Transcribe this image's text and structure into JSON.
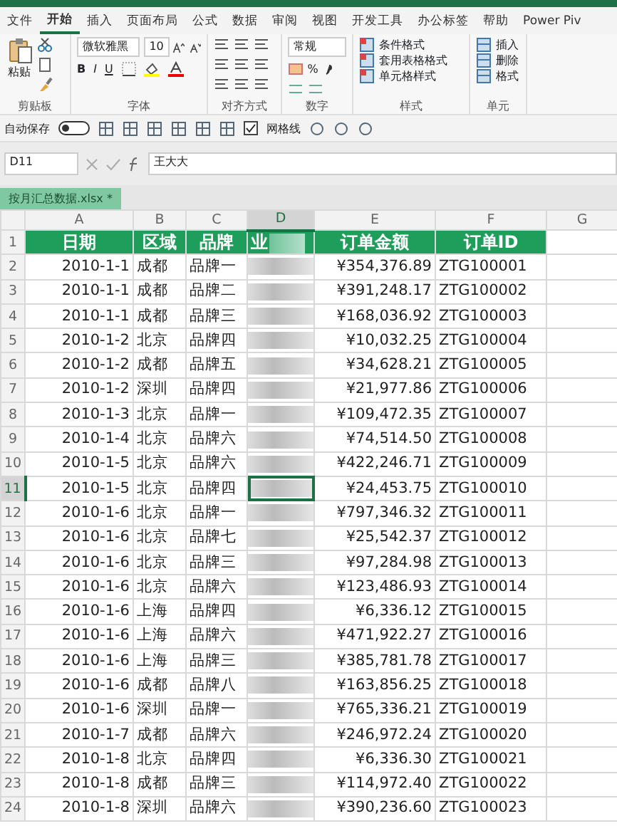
{
  "ribbon_tabs": [
    {
      "label": "文件",
      "selected": false
    },
    {
      "label": "开始",
      "selected": true
    },
    {
      "label": "插入",
      "selected": false
    },
    {
      "label": "页面布局",
      "selected": false
    },
    {
      "label": "公式",
      "selected": false
    },
    {
      "label": "数据",
      "selected": false
    },
    {
      "label": "审阅",
      "selected": false
    },
    {
      "label": "视图",
      "selected": false
    },
    {
      "label": "开发工具",
      "selected": false
    },
    {
      "label": "办公标签",
      "selected": false
    },
    {
      "label": "帮助",
      "selected": false
    },
    {
      "label": "Power Piv",
      "selected": false
    }
  ],
  "clipboard": {
    "paste": "粘贴",
    "label": "剪贴板"
  },
  "font": {
    "name": "微软雅黑",
    "size": "10",
    "bold": "B",
    "italic": "I",
    "underline": "U",
    "label": "字体"
  },
  "alignment": {
    "label": "对齐方式"
  },
  "number": {
    "format": "常规",
    "percent": "%",
    "label": "数字"
  },
  "styles": {
    "items": [
      "条件格式",
      "套用表格格式",
      "单元格样式"
    ],
    "label": "样式"
  },
  "cells": {
    "items": [
      "插入",
      "删除",
      "格式"
    ],
    "label": "单元"
  },
  "quick_access": {
    "autosave": "自动保存",
    "autosave_on": false,
    "gridlines": "网格线",
    "gridlines_checked": true
  },
  "formula_bar": {
    "name_box": "D11",
    "value": "王大大"
  },
  "file_tab": {
    "name": "按月汇总数据.xlsx *"
  },
  "sheet": {
    "columns": [
      {
        "letter": "A",
        "selected": false
      },
      {
        "letter": "B",
        "selected": false
      },
      {
        "letter": "C",
        "selected": false
      },
      {
        "letter": "D",
        "selected": true
      },
      {
        "letter": "E",
        "selected": false
      },
      {
        "letter": "F",
        "selected": false
      },
      {
        "letter": "G",
        "selected": false
      }
    ],
    "header_row": {
      "num": "1",
      "cells": [
        "日期",
        "区域",
        "品牌",
        "业",
        "订单金额",
        "订单ID"
      ]
    },
    "rows": [
      {
        "num": "2",
        "selected": false,
        "date": "2010-1-1",
        "region": "成都",
        "brand": "品牌一",
        "amount": "¥354,376.89",
        "order_id": "ZTG100001"
      },
      {
        "num": "3",
        "selected": false,
        "date": "2010-1-1",
        "region": "成都",
        "brand": "品牌二",
        "amount": "¥391,248.17",
        "order_id": "ZTG100002"
      },
      {
        "num": "4",
        "selected": false,
        "date": "2010-1-1",
        "region": "成都",
        "brand": "品牌三",
        "amount": "¥168,036.92",
        "order_id": "ZTG100003"
      },
      {
        "num": "5",
        "selected": false,
        "date": "2010-1-2",
        "region": "北京",
        "brand": "品牌四",
        "amount": "¥10,032.25",
        "order_id": "ZTG100004"
      },
      {
        "num": "6",
        "selected": false,
        "date": "2010-1-2",
        "region": "成都",
        "brand": "品牌五",
        "amount": "¥34,628.21",
        "order_id": "ZTG100005"
      },
      {
        "num": "7",
        "selected": false,
        "date": "2010-1-2",
        "region": "深圳",
        "brand": "品牌四",
        "amount": "¥21,977.86",
        "order_id": "ZTG100006"
      },
      {
        "num": "8",
        "selected": false,
        "date": "2010-1-3",
        "region": "北京",
        "brand": "品牌一",
        "amount": "¥109,472.35",
        "order_id": "ZTG100007"
      },
      {
        "num": "9",
        "selected": false,
        "date": "2010-1-4",
        "region": "北京",
        "brand": "品牌六",
        "amount": "¥74,514.50",
        "order_id": "ZTG100008"
      },
      {
        "num": "10",
        "selected": false,
        "date": "2010-1-5",
        "region": "北京",
        "brand": "品牌六",
        "amount": "¥422,246.71",
        "order_id": "ZTG100009"
      },
      {
        "num": "11",
        "selected": true,
        "date": "2010-1-5",
        "region": "北京",
        "brand": "品牌四",
        "amount": "¥24,453.75",
        "order_id": "ZTG100010"
      },
      {
        "num": "12",
        "selected": false,
        "date": "2010-1-6",
        "region": "北京",
        "brand": "品牌一",
        "amount": "¥797,346.32",
        "order_id": "ZTG100011"
      },
      {
        "num": "13",
        "selected": false,
        "date": "2010-1-6",
        "region": "北京",
        "brand": "品牌七",
        "amount": "¥25,542.37",
        "order_id": "ZTG100012"
      },
      {
        "num": "14",
        "selected": false,
        "date": "2010-1-6",
        "region": "北京",
        "brand": "品牌三",
        "amount": "¥97,284.98",
        "order_id": "ZTG100013"
      },
      {
        "num": "15",
        "selected": false,
        "date": "2010-1-6",
        "region": "北京",
        "brand": "品牌六",
        "amount": "¥123,486.93",
        "order_id": "ZTG100014"
      },
      {
        "num": "16",
        "selected": false,
        "date": "2010-1-6",
        "region": "上海",
        "brand": "品牌四",
        "amount": "¥6,336.12",
        "order_id": "ZTG100015"
      },
      {
        "num": "17",
        "selected": false,
        "date": "2010-1-6",
        "region": "上海",
        "brand": "品牌六",
        "amount": "¥471,922.27",
        "order_id": "ZTG100016"
      },
      {
        "num": "18",
        "selected": false,
        "date": "2010-1-6",
        "region": "上海",
        "brand": "品牌三",
        "amount": "¥385,781.78",
        "order_id": "ZTG100017"
      },
      {
        "num": "19",
        "selected": false,
        "date": "2010-1-6",
        "region": "成都",
        "brand": "品牌八",
        "amount": "¥163,856.25",
        "order_id": "ZTG100018"
      },
      {
        "num": "20",
        "selected": false,
        "date": "2010-1-6",
        "region": "深圳",
        "brand": "品牌一",
        "amount": "¥765,336.21",
        "order_id": "ZTG100019"
      },
      {
        "num": "21",
        "selected": false,
        "date": "2010-1-7",
        "region": "成都",
        "brand": "品牌六",
        "amount": "¥246,972.24",
        "order_id": "ZTG100020"
      },
      {
        "num": "22",
        "selected": false,
        "date": "2010-1-8",
        "region": "北京",
        "brand": "品牌四",
        "amount": "¥6,336.30",
        "order_id": "ZTG100021"
      },
      {
        "num": "23",
        "selected": false,
        "date": "2010-1-8",
        "region": "成都",
        "brand": "品牌三",
        "amount": "¥114,972.40",
        "order_id": "ZTG100022"
      },
      {
        "num": "24",
        "selected": false,
        "date": "2010-1-8",
        "region": "深圳",
        "brand": "品牌六",
        "amount": "¥390,236.60",
        "order_id": "ZTG100023"
      }
    ]
  }
}
